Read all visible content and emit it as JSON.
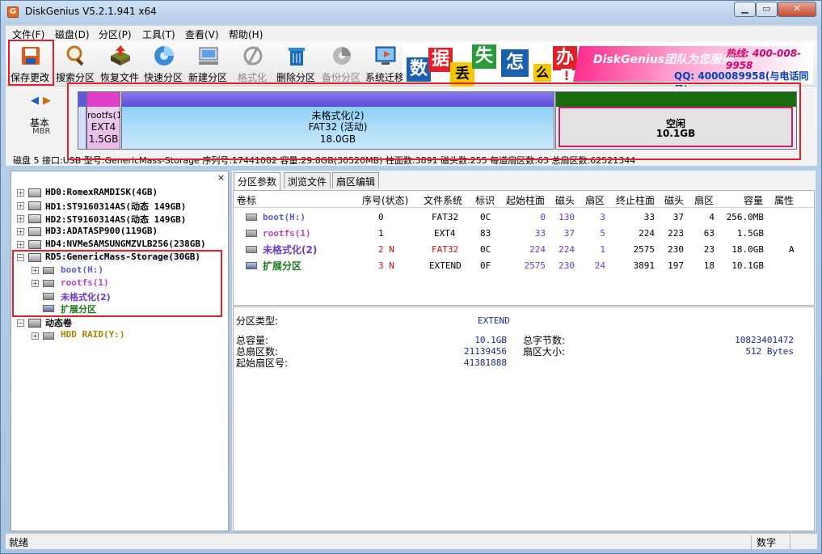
{
  "app": {
    "title": "DiskGenius V5.2.1.941 x64",
    "icon_letter": "G"
  },
  "window_buttons": {
    "minimize": "▁",
    "maximize": "▭",
    "close": "✕"
  },
  "menu": [
    "文件(F)",
    "磁盘(D)",
    "分区(P)",
    "工具(T)",
    "查看(V)",
    "帮助(H)"
  ],
  "toolbar": [
    {
      "label": "保存更改",
      "icon": "save-icon"
    },
    {
      "label": "搜索分区",
      "icon": "search-icon"
    },
    {
      "label": "恢复文件",
      "icon": "restore-icon"
    },
    {
      "label": "快速分区",
      "icon": "quick-partition-icon"
    },
    {
      "label": "新建分区",
      "icon": "new-partition-icon"
    },
    {
      "label": "格式化",
      "icon": "format-icon"
    },
    {
      "label": "删除分区",
      "icon": "delete-icon"
    },
    {
      "label": "备份分区",
      "icon": "backup-icon"
    },
    {
      "label": "系统迁移",
      "icon": "migrate-icon"
    }
  ],
  "banner": {
    "chars": [
      "数",
      "据",
      "丢",
      "失",
      "怎",
      "么",
      "办",
      "!"
    ],
    "title": "DiskGenius团队为您服务",
    "phone": "热线: 400-008-9958",
    "qq": "QQ: 4000089958(与电话同号)"
  },
  "disk_map": {
    "nav_left": "◀",
    "nav_right": "▶",
    "type": "基本",
    "scheme": "MBR",
    "partitions": [
      {
        "name": "rootfs(1",
        "fs": "EXT4",
        "size": "1.5GB"
      },
      {
        "name": "未格式化(2)",
        "fs": "FAT32 (活动)",
        "size": "18.0GB"
      },
      {
        "name": "空闲",
        "size": "10.1GB"
      }
    ],
    "info": "磁盘 5 接口:USB  型号:GenericMass-Storage  序列号:17441082  容量:29.8GB(30520MB)  柱面数:3891  磁头数:255  每道扇区数:63  总扇区数:62521344"
  },
  "tree": {
    "close": "×",
    "disks": [
      "HD0:RomexRAMDISK(4GB)",
      "HD1:ST9160314AS(动态 149GB)",
      "HD2:ST9160314AS(动态 149GB)",
      "HD3:ADATASP900(119GB)",
      "HD4:NVMeSAMSUNGMZVLB256(238GB)",
      "RD5:GenericMass-Storage(30GB)"
    ],
    "rd5_children": [
      "boot(H:)",
      "rootfs(1)",
      "未格式化(2)",
      "扩展分区"
    ],
    "dynamic": "动态卷",
    "raid": "HDD RAID(Y:)"
  },
  "tabs": [
    "分区参数",
    "浏览文件",
    "扇区编辑"
  ],
  "table": {
    "headers": [
      "卷标",
      "序号(状态)",
      "文件系统",
      "标识",
      "起始柱面",
      "磁头",
      "扇区",
      "终止柱面",
      "磁头",
      "扇区",
      "容量",
      "属性"
    ],
    "rows": [
      {
        "label": "boot(H:)",
        "no": "0",
        "fs": "FAT32",
        "id": "0C",
        "sc": "0",
        "sh": "130",
        "ss": "3",
        "ec": "33",
        "eh": "37",
        "es": "4",
        "cap": "256.0MB",
        "attr": ""
      },
      {
        "label": "rootfs(1)",
        "no": "1",
        "fs": "EXT4",
        "id": "83",
        "sc": "33",
        "sh": "37",
        "ss": "5",
        "ec": "224",
        "eh": "223",
        "es": "63",
        "cap": "1.5GB",
        "attr": ""
      },
      {
        "label": "未格式化(2)",
        "no": "2 N",
        "fs": "FAT32",
        "id": "0C",
        "sc": "224",
        "sh": "224",
        "ss": "1",
        "ec": "2575",
        "eh": "230",
        "es": "23",
        "cap": "18.0GB",
        "attr": "A"
      },
      {
        "label": "扩展分区",
        "no": "3 N",
        "fs": "EXTEND",
        "id": "0F",
        "sc": "2575",
        "sh": "230",
        "ss": "24",
        "ec": "3891",
        "eh": "197",
        "es": "18",
        "cap": "10.1GB",
        "attr": ""
      }
    ]
  },
  "info": {
    "type_label": "分区类型:",
    "type_value": "EXTEND",
    "total_cap_label": "总容量:",
    "total_cap": "10.1GB",
    "total_sectors_label": "总扇区数:",
    "total_sectors": "21139456",
    "start_sector_label": "起始扇区号:",
    "start_sector": "41381888",
    "total_bytes_label": "总字节数:",
    "total_bytes": "10823401472",
    "sector_size_label": "扇区大小:",
    "sector_size": "512 Bytes"
  },
  "status": {
    "left": "就绪",
    "right": "数字"
  },
  "colors": {
    "highlight": "#e0212a",
    "free_border": "#c8206c",
    "boot": "#5a5adc",
    "rootfs": "#c040c0",
    "unformatted": "#6a3ad0",
    "extend": "#1a7a1a",
    "red_text": "#d01010"
  }
}
